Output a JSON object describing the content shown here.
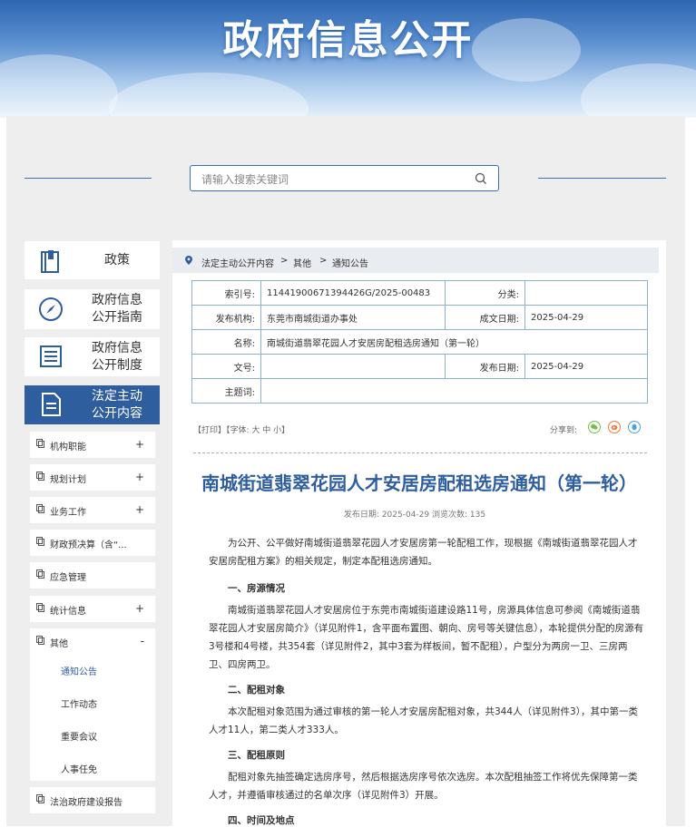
{
  "banner": {
    "title": "政府信息公开"
  },
  "search": {
    "placeholder": "请输入搜索关键词"
  },
  "nav": [
    {
      "label_line1": "政策",
      "label_line2": ""
    },
    {
      "label_line1": "政府信息",
      "label_line2": "公开指南"
    },
    {
      "label_line1": "政府信息",
      "label_line2": "公开制度"
    },
    {
      "label_line1": "法定主动",
      "label_line2": "公开内容"
    }
  ],
  "sub_items": [
    {
      "label": "机构职能",
      "toggle": "+"
    },
    {
      "label": "规划计划",
      "toggle": "+"
    },
    {
      "label": "业务工作",
      "toggle": "+"
    },
    {
      "label": "财政预决算（含“...",
      "toggle": ""
    },
    {
      "label": "应急管理",
      "toggle": ""
    },
    {
      "label": "统计信息",
      "toggle": "+"
    },
    {
      "label": "其他",
      "toggle": "-"
    },
    {
      "label": "法治政府建设报告",
      "toggle": ""
    }
  ],
  "sub_children": [
    "通知公告",
    "工作动态",
    "重要会议",
    "人事任免"
  ],
  "breadcrumb": [
    "法定主动公开内容",
    "其他",
    "通知公告"
  ],
  "breadcrumb_sep": ">",
  "meta": {
    "index_label": "索引号:",
    "index_value": "11441900671394426G/2025-00483",
    "category_label": "分类:",
    "category_value": "",
    "publisher_label": "发布机构:",
    "publisher_value": "东莞市南城街道办事处",
    "created_label": "成文日期:",
    "created_value": "2025-04-29",
    "name_label": "名称:",
    "name_value": "南城街道翡翠花园人才安居房配租选房通知（第一轮）",
    "docno_label": "文号:",
    "docno_value": "",
    "pubdate_label": "发布日期:",
    "pubdate_value": "2025-04-29",
    "subject_label": "主题词:",
    "subject_value": ""
  },
  "tools": "【打印】【字体: 大  中  小】",
  "share_label": "分享到:",
  "share_icons": [
    "wechat-icon",
    "weibo-icon",
    "qq-icon"
  ],
  "article": {
    "title": "南城街道翡翠花园人才安居房配租选房通知（第一轮）",
    "info": "发布日期: 2025-04-29   浏览次数: 135",
    "intro": "为公开、公平做好南城街道翡翠花园人才安居房第一轮配租工作，现根据《南城街道翡翠花园人才安居房配租方案》的相关规定，制定本配租选房通知。",
    "s1_title": "一、房源情况",
    "s1_text": "南城街道翡翠花园人才安居房位于东莞市南城街道建设路11号，房源具体信息可参阅《南城街道翡翠花园人才安居房简介》（详见附件1，含平面布置图、朝向、房号等关键信息），本轮提供分配的房源有3号楼和4号楼，共354套（详见附件2，其中3套为样板间，暂不配租），户型分为两房一卫、三房两卫、四房两卫。",
    "s2_title": "二、配租对象",
    "s2_text": "本次配租对象范围为通过审核的第一轮人才安居房配租对象，共344人（详见附件3），其中第一类人才11人，第二类人才333人。",
    "s3_title": "三、配租原则",
    "s3_text": "配租对象先抽签确定选房序号，然后根据选房序号依次选房。本次配租抽签工作将优先保障第一类人才，并遵循审核通过的名单次序（详见附件3）开展。",
    "s4_title": "四、时间及地点"
  },
  "colors": {
    "primary": "#2f5e9e",
    "banner": "#2f67b1",
    "border": "#8eb0d6"
  }
}
